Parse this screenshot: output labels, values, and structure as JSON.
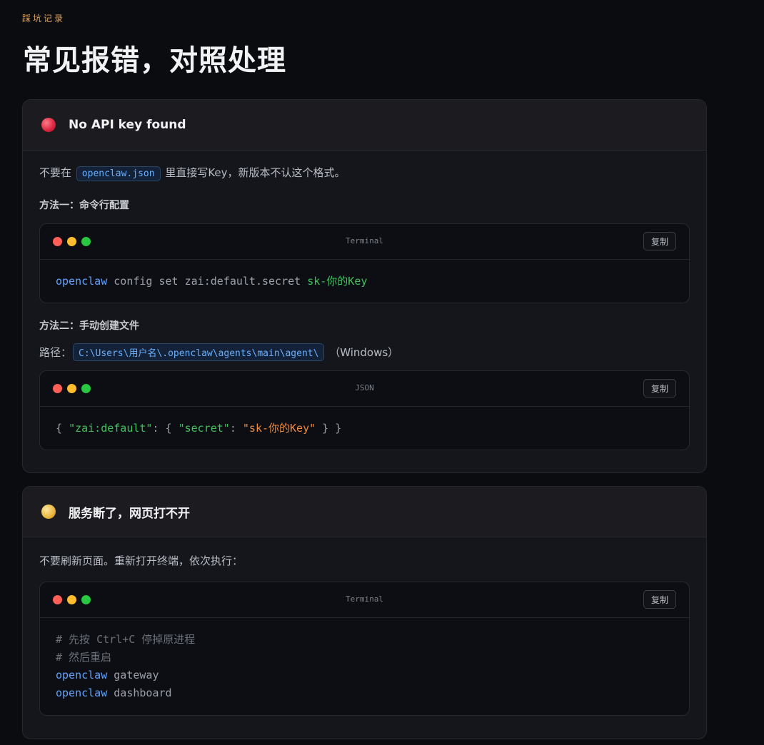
{
  "header": {
    "eyebrow": "踩坑记录",
    "title": "常见报错，对照处理"
  },
  "cards": [
    {
      "status_color": "red",
      "title": "No API key found",
      "intro_before": "不要在",
      "intro_code": "openclaw.json",
      "intro_after": "里直接写Key，新版本不认这个格式。",
      "method1_label": "方法一：命令行配置",
      "terminal1": {
        "label": "Terminal",
        "copy_label": "复制",
        "cmd": "openclaw",
        "args": " config set zai:default.secret ",
        "value": "sk-你的Key"
      },
      "method2_label": "方法二：手动创建文件",
      "path_label": "路径：",
      "path_code": "C:\\Users\\用户名\\.openclaw\\agents\\main\\agent\\",
      "path_suffix": "（Windows）",
      "terminal2": {
        "label": "JSON",
        "copy_label": "复制",
        "p1": "{ ",
        "k1": "\"zai:default\"",
        "p2": ": { ",
        "k2": "\"secret\"",
        "p3": ": ",
        "v1": "\"sk-你的Key\"",
        "p4": " } }"
      }
    },
    {
      "status_color": "yellow",
      "title": "服务断了，网页打不开",
      "intro": "不要刷新页面。重新打开终端，依次执行：",
      "terminal": {
        "label": "Terminal",
        "copy_label": "复制",
        "comment1": "# 先按 Ctrl+C 停掉原进程",
        "comment2": "# 然后重启",
        "cmd1": "openclaw",
        "arg1": " gateway",
        "cmd2": "openclaw",
        "arg2": " dashboard"
      }
    }
  ],
  "colors": {
    "accent_orange": "#e3a35a",
    "command_blue": "#5ea3ff",
    "string_green": "#3fc25b",
    "value_orange": "#f08a3c"
  }
}
